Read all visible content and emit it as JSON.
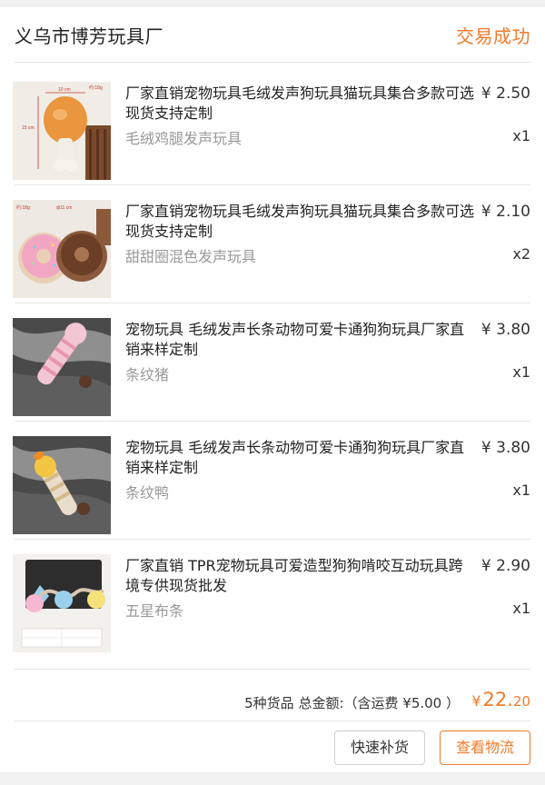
{
  "header": {
    "shop_name": "义乌市博芳玩具厂",
    "status": "交易成功"
  },
  "items": [
    {
      "title": "厂家直销宠物玩具毛绒发声狗玩具猫玩具集合多款可选现货支持定制",
      "price": "¥ 2.50",
      "variant": "毛绒鸡腿发声玩具",
      "qty": "x1",
      "image_labels": [
        "约:18g",
        "10 cm",
        "15 cm"
      ]
    },
    {
      "title": "厂家直销宠物玩具毛绒发声狗玩具猫玩具集合多款可选现货支持定制",
      "price": "¥ 2.10",
      "variant": "甜甜圈混色发声玩具",
      "qty": "x2",
      "image_labels": [
        "约:18g",
        "ф11 cm"
      ]
    },
    {
      "title": "宠物玩具 毛绒发声长条动物可爱卡通狗狗玩具厂家直销来样定制",
      "price": "¥ 3.80",
      "variant": "条纹猪",
      "qty": "x1"
    },
    {
      "title": "宠物玩具 毛绒发声长条动物可爱卡通狗狗玩具厂家直销来样定制",
      "price": "¥ 3.80",
      "variant": "条纹鸭",
      "qty": "x1"
    },
    {
      "title": "厂家直销 TPR宠物玩具可爱造型狗狗啃咬互动玩具跨境专供现货批发",
      "price": "¥ 2.90",
      "variant": "五星布条",
      "qty": "x1"
    }
  ],
  "summary": {
    "text": "5种货品 总金额:（含运费 ¥5.00 ）",
    "currency": "¥",
    "total_int": "22.",
    "total_dec": "20"
  },
  "actions": {
    "restock_label": "快速补货",
    "logistics_label": "查看物流"
  },
  "colors": {
    "accent": "#f07a2a",
    "muted": "#999999"
  }
}
